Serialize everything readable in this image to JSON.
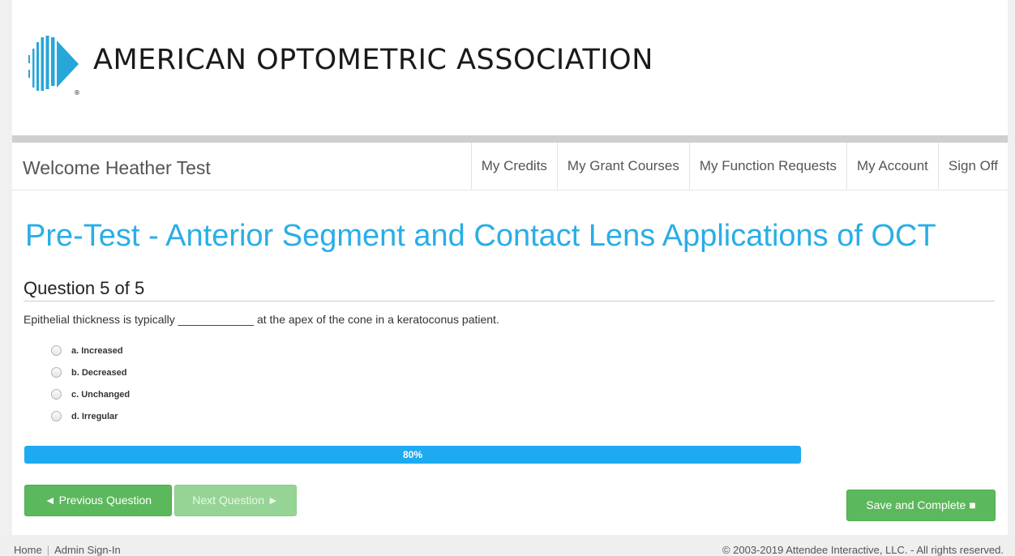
{
  "header": {
    "logo_text": "AMERICAN OPTOMETRIC ASSOCIATION"
  },
  "navbar": {
    "welcome": "Welcome Heather Test",
    "links": [
      "My Credits",
      "My Grant Courses",
      "My Function Requests",
      "My Account",
      "Sign Off"
    ]
  },
  "main": {
    "title": "Pre-Test - Anterior Segment and Contact Lens Applications of OCT",
    "question_header": "Question 5 of 5",
    "question_text": "Epithelial thickness is typically ____________ at the apex of the cone in a keratoconus patient.",
    "options": [
      "a. Increased",
      "b. Decreased",
      "c. Unchanged",
      "d. Irregular"
    ],
    "progress": {
      "label": "80%",
      "value": 0.8
    }
  },
  "buttons": {
    "previous": "◄ Previous Question",
    "next": "Next Question ►",
    "save": "Save and Complete ■"
  },
  "footer": {
    "home": "Home",
    "admin": "Admin Sign-In",
    "copyright": "© 2003-2019 Attendee Interactive, LLC. - All rights reserved."
  },
  "colors": {
    "title": "#29aee6",
    "progress": "#1eaaf1",
    "button_green": "#5cb85c"
  }
}
